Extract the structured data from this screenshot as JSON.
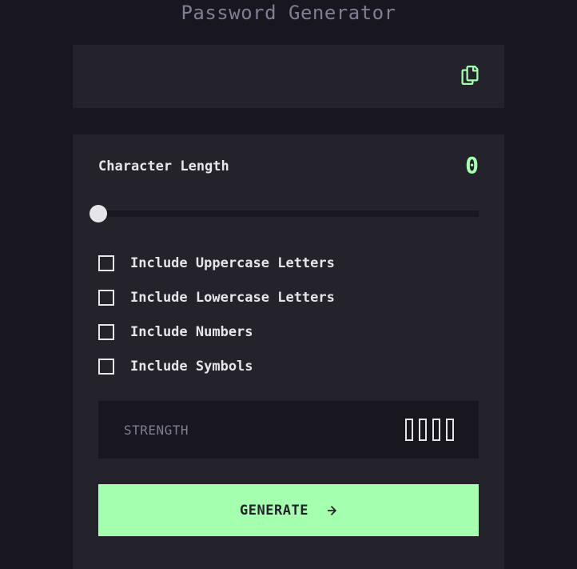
{
  "app": {
    "title": "Password Generator"
  },
  "password": {
    "value": "",
    "copy_icon": "copy-icon"
  },
  "length": {
    "label": "Character Length",
    "value": "0",
    "slider_fraction": 0
  },
  "options": [
    {
      "label": "Include Uppercase Letters",
      "checked": false
    },
    {
      "label": "Include Lowercase Letters",
      "checked": false
    },
    {
      "label": "Include Numbers",
      "checked": false
    },
    {
      "label": "Include Symbols",
      "checked": false
    }
  ],
  "strength": {
    "label": "STRENGTH",
    "level_text": "",
    "bars_filled": 0,
    "bars_total": 4
  },
  "generate": {
    "label": "GENERATE",
    "icon": "arrow-right-icon"
  },
  "colors": {
    "background": "#18171f",
    "panel": "#24232c",
    "accent": "#a4ffaf",
    "text": "#e6e5ea",
    "muted": "#817d92"
  }
}
